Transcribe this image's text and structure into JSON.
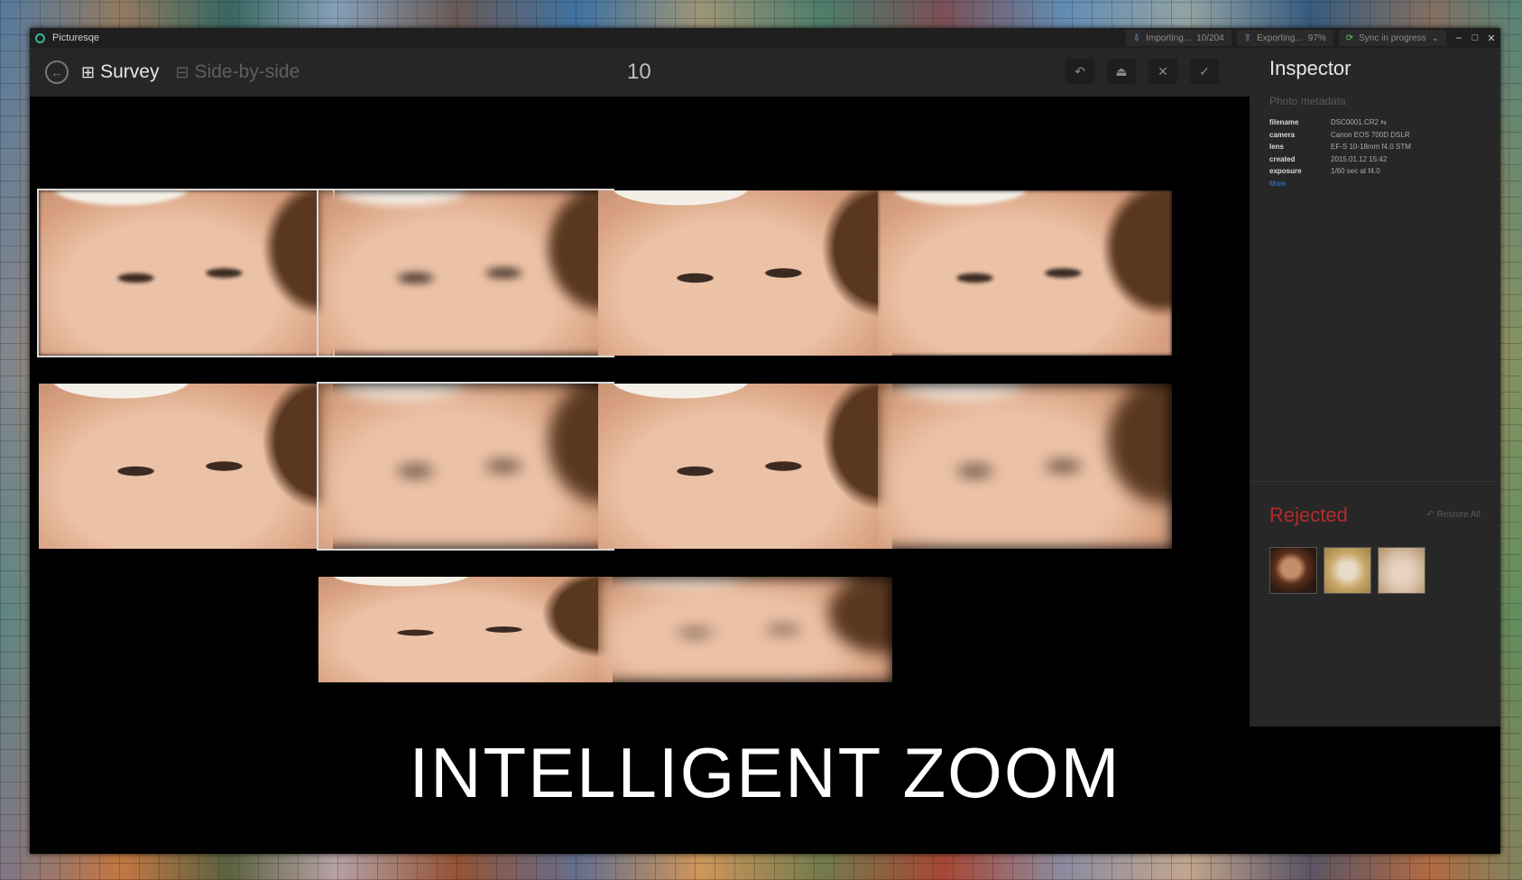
{
  "window": {
    "title": "Picturesqe",
    "controls": [
      "–",
      "□",
      "✕"
    ]
  },
  "status_bar": [
    {
      "label": "Importing...",
      "detail": "10/204",
      "icon": "import-icon"
    },
    {
      "label": "Exporting...",
      "detail": "97%",
      "icon": "export-icon"
    },
    {
      "label": "Sync in progress",
      "detail": "⌄",
      "icon": "sync-icon"
    }
  ],
  "toolbar": {
    "modes": [
      {
        "label": "Survey",
        "icon": "grid-icon",
        "active": true
      },
      {
        "label": "Side-by-side",
        "icon": "split-icon",
        "active": false
      }
    ],
    "count": "10",
    "tools": [
      {
        "name": "undo-tool",
        "glyph": "↶"
      },
      {
        "name": "stack-tool",
        "glyph": "⏏"
      },
      {
        "name": "reject-tool",
        "glyph": "✕"
      },
      {
        "name": "accept-tool",
        "glyph": "✓"
      }
    ]
  },
  "inspector": {
    "title": "Inspector",
    "subtitle": "Photo metadata",
    "metadata": [
      {
        "key": "filename",
        "value": "DSC0001.CR2  ⇆"
      },
      {
        "key": "camera",
        "value": "Canon EOS 700D DSLR"
      },
      {
        "key": "lens",
        "value": "EF-S 10-18mm f4.0 STM"
      },
      {
        "key": "created",
        "value": "2015.01.12  15:42"
      },
      {
        "key": "exposure",
        "value": "1/60 sec at f4.0"
      }
    ],
    "more_link": "More",
    "rejected_title": "Rejected",
    "restore_label": "↶ Restore All",
    "rejected_count": 3
  },
  "photos": [
    {
      "name": "photo-1",
      "selected": true,
      "blur": 1
    },
    {
      "name": "photo-2",
      "selected": true,
      "blur": 2
    },
    {
      "name": "photo-3",
      "selected": false,
      "blur": 0
    },
    {
      "name": "photo-4",
      "selected": false,
      "blur": 1
    },
    {
      "name": "photo-5",
      "selected": false,
      "blur": 0
    },
    {
      "name": "photo-6",
      "selected": true,
      "blur": 3
    },
    {
      "name": "photo-7",
      "selected": false,
      "blur": 0
    },
    {
      "name": "photo-8",
      "selected": false,
      "blur": 3
    },
    {
      "name": "photo-9",
      "selected": false,
      "blur": 0
    },
    {
      "name": "photo-10",
      "selected": false,
      "blur": 3
    }
  ],
  "caption": "INTELLIGENT ZOOM",
  "colors": {
    "accent": "#2fb89a",
    "rejected": "#b52b2b",
    "link": "#3d7fc6"
  }
}
